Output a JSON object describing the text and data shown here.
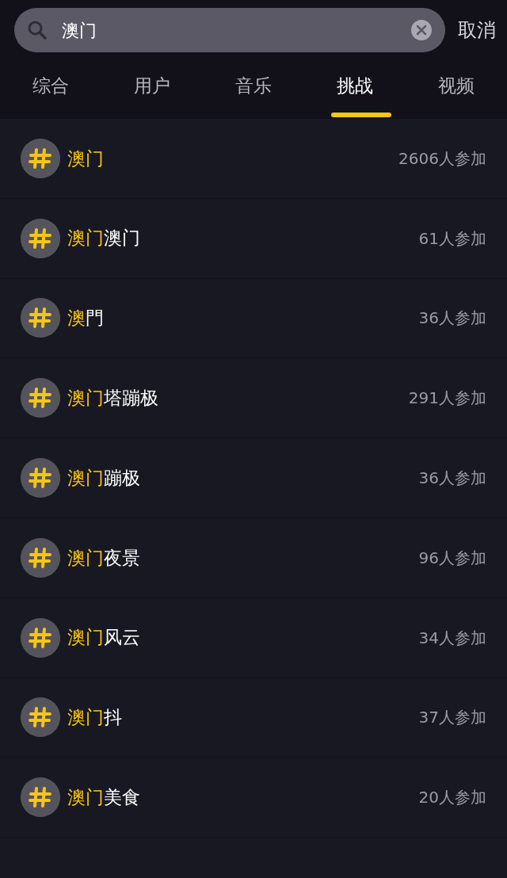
{
  "search": {
    "value": "澳门",
    "cancel": "取消"
  },
  "tabs": [
    {
      "label": "综合",
      "selected": false
    },
    {
      "label": "用户",
      "selected": false
    },
    {
      "label": "音乐",
      "selected": false
    },
    {
      "label": "挑战",
      "selected": true
    },
    {
      "label": "视频",
      "selected": false
    }
  ],
  "challenges": [
    {
      "match": "澳门",
      "count": "2606人参加"
    },
    {
      "match": "澳门",
      "rest": "澳门",
      "count": "61人参加"
    },
    {
      "match": "澳",
      "rest": "門",
      "count": "36人参加"
    },
    {
      "match": "澳门",
      "rest": "塔蹦极",
      "count": "291人参加"
    },
    {
      "match": "澳门",
      "rest": "蹦极",
      "count": "36人参加"
    },
    {
      "match": "澳门",
      "rest": "夜景",
      "count": "96人参加"
    },
    {
      "match": "澳门",
      "rest": "风云",
      "count": "34人参加"
    },
    {
      "match": "澳门",
      "rest": "抖",
      "count": "37人参加"
    },
    {
      "match": "澳门",
      "rest": "美食",
      "count": "20人参加"
    }
  ]
}
